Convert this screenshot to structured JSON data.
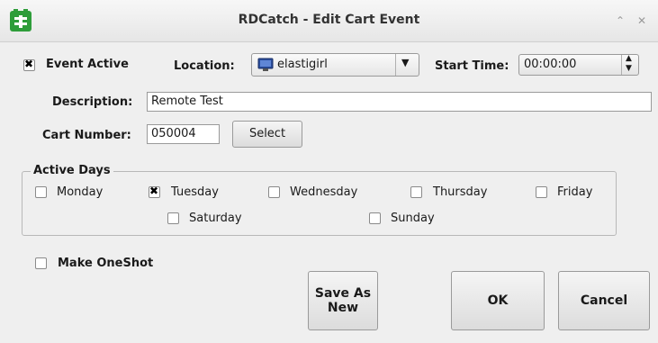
{
  "window": {
    "title": "RDCatch - Edit Cart Event",
    "app_icon": "rdcatch-icon"
  },
  "event_active": {
    "label": "Event Active",
    "checked": true
  },
  "location": {
    "label": "Location:",
    "value": "elastigirl",
    "icon": "monitor-icon"
  },
  "start_time": {
    "label": "Start Time:",
    "value": "00:00:00"
  },
  "description": {
    "label": "Description:",
    "value": "Remote Test"
  },
  "cart_number": {
    "label": "Cart Number:",
    "value": "050004",
    "select_label": "Select"
  },
  "active_days": {
    "title": "Active Days",
    "days": [
      {
        "label": "Monday",
        "checked": false
      },
      {
        "label": "Tuesday",
        "checked": true
      },
      {
        "label": "Wednesday",
        "checked": false
      },
      {
        "label": "Thursday",
        "checked": false
      },
      {
        "label": "Friday",
        "checked": false
      },
      {
        "label": "Saturday",
        "checked": false
      },
      {
        "label": "Sunday",
        "checked": false
      }
    ]
  },
  "make_oneshot": {
    "label": "Make OneShot",
    "checked": false
  },
  "buttons": {
    "save_as_new_line1": "Save As",
    "save_as_new_line2": "New",
    "ok": "OK",
    "cancel": "Cancel"
  },
  "colors": {
    "accent_green": "#2e9d3a",
    "background": "#efefef"
  }
}
